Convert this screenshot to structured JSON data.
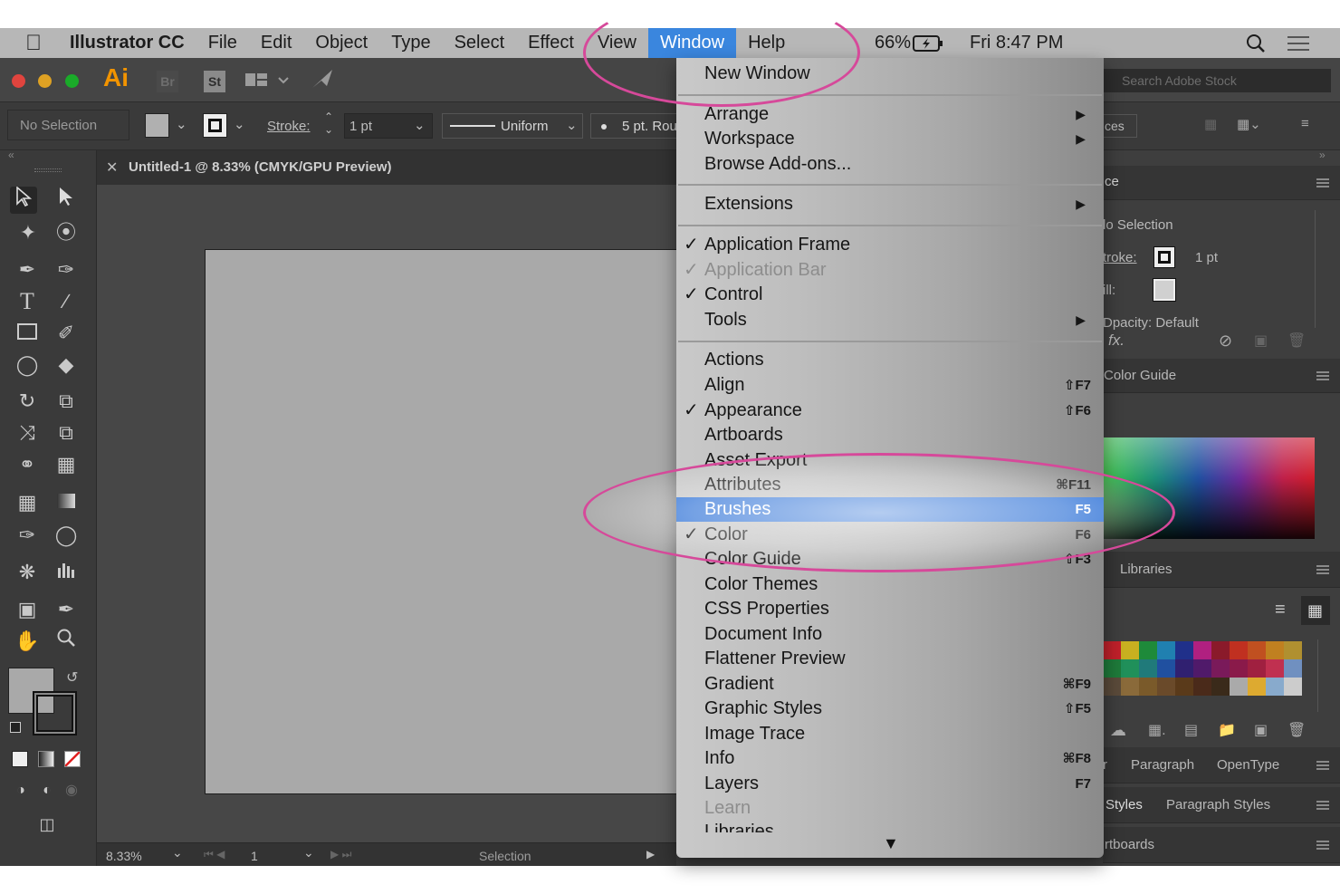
{
  "menubar": {
    "apple_icon": "apple-icon",
    "app_name": "Illustrator CC",
    "items": [
      "File",
      "Edit",
      "Object",
      "Type",
      "Select",
      "Effect",
      "View",
      "Window",
      "Help"
    ],
    "active_item": "Window",
    "battery": "66%",
    "clock": "Fri 8:47 PM"
  },
  "app": {
    "logo": "Ai",
    "bridge": "Br",
    "stock": "St",
    "search_stock_placeholder": "Search Adobe Stock"
  },
  "control_bar": {
    "selection": "No Selection",
    "stroke_label": "Stroke:",
    "stroke_value": "1 pt",
    "profile": "Uniform",
    "brush": "5 pt. Rou"
  },
  "document_tab": {
    "title": "Untitled-1 @ 8.33% (CMYK/GPU Preview)"
  },
  "status_bar": {
    "zoom": "8.33%",
    "artboard": "1",
    "tool": "Selection"
  },
  "right_panels": {
    "properties_tab": "ces",
    "appearance_tab": "ce",
    "no_selection": "lo Selection",
    "stroke_label": "troke:",
    "stroke_value": "1 pt",
    "fill_label": "ill:",
    "opacity": "Dpacity: Default",
    "color_guide": "Color Guide",
    "libraries": "Libraries",
    "char_tab": "r",
    "paragraph_tab": "Paragraph",
    "opentype_tab": "OpenType",
    "styles_tab": "Styles",
    "paragraph_styles_tab": "Paragraph Styles",
    "artboards_tab": "rtboards"
  },
  "window_menu": {
    "items": [
      {
        "label": "New Window",
        "checked": false,
        "disabled": false,
        "shortcut": "",
        "submenu": false
      },
      {
        "label": "Arrange",
        "checked": false,
        "disabled": false,
        "shortcut": "",
        "submenu": true
      },
      {
        "label": "Workspace",
        "checked": false,
        "disabled": false,
        "shortcut": "",
        "submenu": true
      },
      {
        "label": "Browse Add-ons...",
        "checked": false,
        "disabled": false,
        "shortcut": "",
        "submenu": false
      },
      {
        "label": "Extensions",
        "checked": false,
        "disabled": false,
        "shortcut": "",
        "submenu": true
      },
      {
        "label": "Application Frame",
        "checked": true,
        "disabled": false,
        "shortcut": "",
        "submenu": false
      },
      {
        "label": "Application Bar",
        "checked": true,
        "disabled": true,
        "shortcut": "",
        "submenu": false
      },
      {
        "label": "Control",
        "checked": true,
        "disabled": false,
        "shortcut": "",
        "submenu": false
      },
      {
        "label": "Tools",
        "checked": false,
        "disabled": false,
        "shortcut": "",
        "submenu": true
      },
      {
        "label": "Actions",
        "checked": false,
        "disabled": false,
        "shortcut": "",
        "submenu": false
      },
      {
        "label": "Align",
        "checked": false,
        "disabled": false,
        "shortcut": "⇧F7",
        "submenu": false
      },
      {
        "label": "Appearance",
        "checked": true,
        "disabled": false,
        "shortcut": "⇧F6",
        "submenu": false
      },
      {
        "label": "Artboards",
        "checked": false,
        "disabled": false,
        "shortcut": "",
        "submenu": false
      },
      {
        "label": "Asset Export",
        "checked": false,
        "disabled": false,
        "shortcut": "",
        "submenu": false
      },
      {
        "label": "Attributes",
        "checked": false,
        "disabled": false,
        "shortcut": "⌘F11",
        "submenu": false
      },
      {
        "label": "Brushes",
        "checked": false,
        "disabled": false,
        "shortcut": "F5",
        "submenu": false,
        "highlighted": true
      },
      {
        "label": "Color",
        "checked": true,
        "disabled": false,
        "shortcut": "F6",
        "submenu": false
      },
      {
        "label": "Color Guide",
        "checked": false,
        "disabled": false,
        "shortcut": "⇧F3",
        "submenu": false
      },
      {
        "label": "Color Themes",
        "checked": false,
        "disabled": false,
        "shortcut": "",
        "submenu": false
      },
      {
        "label": "CSS Properties",
        "checked": false,
        "disabled": false,
        "shortcut": "",
        "submenu": false
      },
      {
        "label": "Document Info",
        "checked": false,
        "disabled": false,
        "shortcut": "",
        "submenu": false
      },
      {
        "label": "Flattener Preview",
        "checked": false,
        "disabled": false,
        "shortcut": "",
        "submenu": false
      },
      {
        "label": "Gradient",
        "checked": false,
        "disabled": false,
        "shortcut": "⌘F9",
        "submenu": false
      },
      {
        "label": "Graphic Styles",
        "checked": false,
        "disabled": false,
        "shortcut": "⇧F5",
        "submenu": false
      },
      {
        "label": "Image Trace",
        "checked": false,
        "disabled": false,
        "shortcut": "",
        "submenu": false
      },
      {
        "label": "Info",
        "checked": false,
        "disabled": false,
        "shortcut": "⌘F8",
        "submenu": false
      },
      {
        "label": "Layers",
        "checked": false,
        "disabled": false,
        "shortcut": "F7",
        "submenu": false
      },
      {
        "label": "Learn",
        "checked": false,
        "disabled": true,
        "shortcut": "",
        "submenu": false
      },
      {
        "label": "Libraries",
        "checked": false,
        "disabled": false,
        "shortcut": "",
        "submenu": false
      }
    ],
    "check_glyph": "✓",
    "submenu_glyph": "▶",
    "scroll_glyph": "▼"
  },
  "colors": {
    "highlight": "#2a6fd6",
    "menubar_active": "#3a86de",
    "annotation": "#d6499a"
  }
}
